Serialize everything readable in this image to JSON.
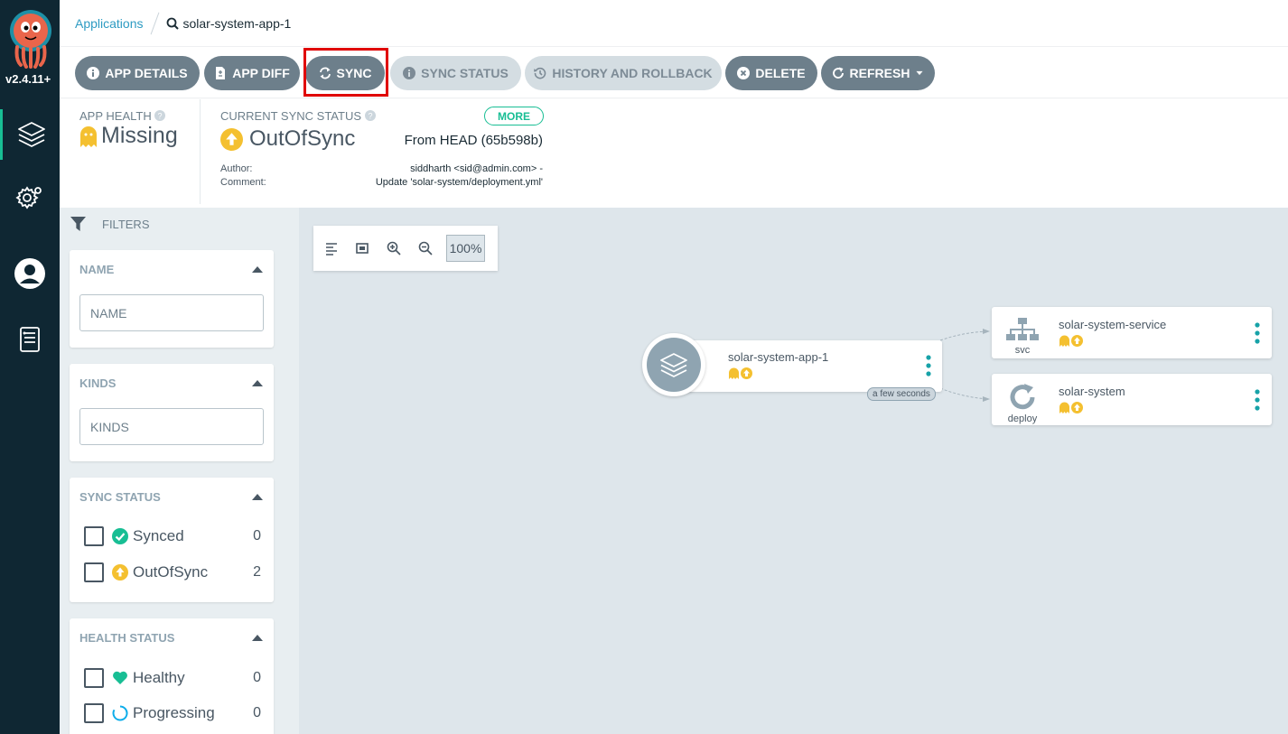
{
  "sidebar": {
    "version": "v2.4.11+",
    "items": [
      {
        "icon": "layers-icon"
      },
      {
        "icon": "gear-icon"
      },
      {
        "icon": "user-icon"
      },
      {
        "icon": "docs-icon"
      }
    ]
  },
  "breadcrumb": {
    "applications": "Applications",
    "app": "solar-system-app-1"
  },
  "toolbar": {
    "app_details": "APP DETAILS",
    "app_diff": "APP DIFF",
    "sync": "SYNC",
    "sync_status": "SYNC STATUS",
    "history": "HISTORY AND ROLLBACK",
    "delete": "DELETE",
    "refresh": "REFRESH"
  },
  "status": {
    "app_health_label": "APP HEALTH",
    "app_health_value": "Missing",
    "sync_label": "CURRENT SYNC STATUS",
    "sync_value": "OutOfSync",
    "more": "MORE",
    "from_head": "From HEAD (65b598b)",
    "author_label": "Author:",
    "author_value": "siddharth <sid@admin.com> -",
    "comment_label": "Comment:",
    "comment_value": "Update 'solar-system/deployment.yml'"
  },
  "filters": {
    "header": "FILTERS",
    "name": {
      "title": "NAME",
      "placeholder": "NAME"
    },
    "kinds": {
      "title": "KINDS",
      "placeholder": "KINDS"
    },
    "sync_status": {
      "title": "SYNC STATUS",
      "items": [
        {
          "label": "Synced",
          "count": "0"
        },
        {
          "label": "OutOfSync",
          "count": "2"
        }
      ]
    },
    "health_status": {
      "title": "HEALTH STATUS",
      "items": [
        {
          "label": "Healthy",
          "count": "0"
        },
        {
          "label": "Progressing",
          "count": "0"
        }
      ]
    }
  },
  "graph": {
    "zoom": "100%",
    "root": {
      "title": "solar-system-app-1"
    },
    "edge_label": "a few seconds",
    "service": {
      "title": "solar-system-service",
      "kind": "svc"
    },
    "deploy": {
      "title": "solar-system",
      "kind": "deploy"
    }
  },
  "colors": {
    "sidebar_bg": "#0f2733",
    "accent": "#18be94",
    "warning": "#f4c030",
    "button": "#6d7f8b",
    "highlight": "#e00000"
  }
}
